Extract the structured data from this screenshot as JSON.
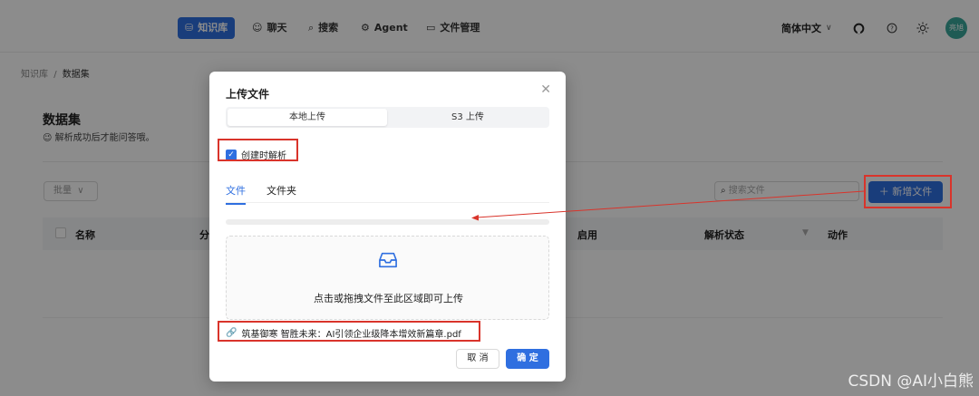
{
  "nav": {
    "items": [
      {
        "icon": "database-icon",
        "glyph": "⛁",
        "label": "知识库",
        "active": true
      },
      {
        "icon": "chat-icon",
        "glyph": "☺",
        "label": "聊天",
        "active": false
      },
      {
        "icon": "search-icon",
        "glyph": "⌕",
        "label": "搜索",
        "active": false
      },
      {
        "icon": "agent-icon",
        "glyph": "⚙",
        "label": "Agent",
        "active": false
      },
      {
        "icon": "folder-icon",
        "glyph": "▭",
        "label": "文件管理",
        "active": false
      }
    ],
    "language": "简体中文",
    "avatar_text": "亮旭"
  },
  "breadcrumb": {
    "root": "知识库",
    "separator": "/",
    "current": "数据集"
  },
  "page": {
    "title": "数据集",
    "subtitle": "解析成功后才能问答哦。",
    "batch_label": "批量",
    "search_placeholder": "搜索文件",
    "add_file_label": "新增文件"
  },
  "table": {
    "columns": [
      "名称",
      "分",
      "启用",
      "解析状态",
      "动作"
    ]
  },
  "modal": {
    "title": "上传文件",
    "segments": [
      "本地上传",
      "S3 上传"
    ],
    "checkbox_label": "创建时解析",
    "tabs": [
      "文件",
      "文件夹"
    ],
    "dropzone_text": "点击或拖拽文件至此区域即可上传",
    "file_name": "筑基御寒 智胜未来：AI引领企业级降本增效新篇章.pdf",
    "cancel_label": "取 消",
    "ok_label": "确 定"
  },
  "colors": {
    "accent": "#2f6fe0",
    "highlight": "#d9342b"
  },
  "watermark": "CSDN @AI小白熊"
}
